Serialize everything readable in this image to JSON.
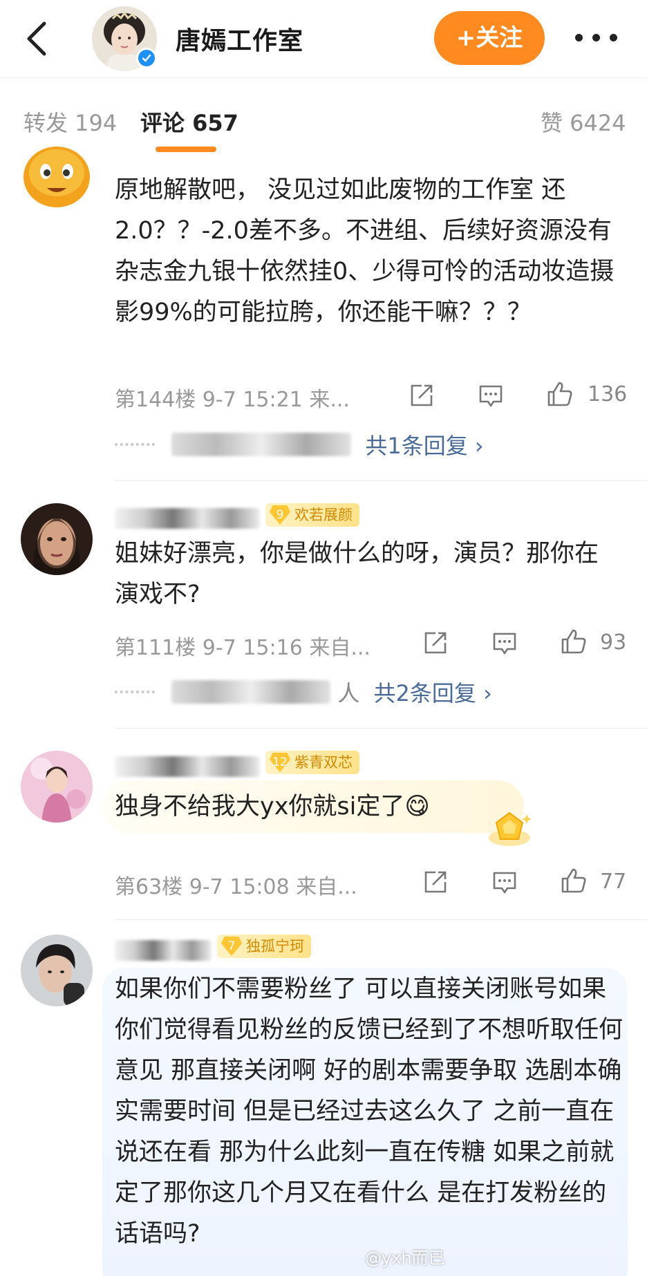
{
  "header": {
    "account_name": "唐嫣工作室",
    "follow_label": "+关注"
  },
  "tabs": {
    "repost": "转发 194",
    "comments": "评论 657",
    "likes": "赞 6424"
  },
  "comments": [
    {
      "text": "原地解散吧， 没见过如此废物的工作室 还2.0？？-2.0差不多。不进组、后续好资源没有杂志金九银十依然挂0、少得可怜的活动妆造摄影99%的可能拉胯，你还能干嘛？？？",
      "meta": "第144楼 9-7 15:21 来...",
      "likes": "136",
      "reply_count": "共1条回复 ›"
    },
    {
      "badge_level": "9",
      "badge_name": "欢若展颜",
      "text": "姐妹好漂亮，你是做什么的呀，演员？那你在演戏不?",
      "meta": "第111楼 9-7 15:16 来自...",
      "likes": "93",
      "reply_tail": "人",
      "reply_count": "共2条回复 ›"
    },
    {
      "badge_level": "12",
      "badge_name": "紫青双芯",
      "text": "独身不给我大yx你就si定了😋",
      "meta": "第63楼 9-7 15:08 来自...",
      "likes": "77"
    },
    {
      "badge_level": "7",
      "badge_name": "独孤宁珂",
      "text": "如果你们不需要粉丝了 可以直接关闭账号如果你们觉得看见粉丝的反馈已经到了不想听取任何意见 那直接关闭啊 好的剧本需要争取 选剧本确实需要时间 但是已经过去这么久了 之前一直在说还在看 那为什么此刻一直在传糖 如果之前就定了那你这几个月又在看什么 是在打发粉丝的话语吗?"
    }
  ],
  "watermark": "@yxh而已",
  "colors": {
    "accent": "#ff8a1f",
    "verified": "#1e90ff",
    "link": "#4a6b99"
  }
}
